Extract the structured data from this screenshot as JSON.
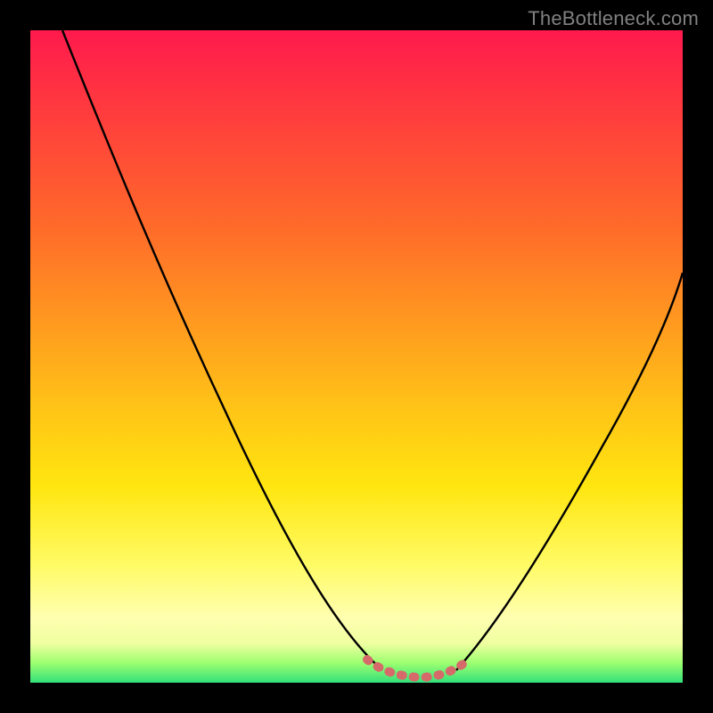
{
  "watermark": "TheBottleneck.com",
  "chart_data": {
    "type": "line",
    "title": "",
    "xlabel": "",
    "ylabel": "",
    "xlim": [
      0,
      100
    ],
    "ylim": [
      0,
      100
    ],
    "grid": false,
    "legend": false,
    "series": [
      {
        "name": "left-curve",
        "color": "#000000",
        "x": [
          5,
          10,
          15,
          20,
          25,
          30,
          35,
          40,
          45,
          50,
          53,
          55
        ],
        "y": [
          100,
          90,
          80,
          70,
          60,
          50,
          40,
          30,
          20,
          10,
          3,
          1
        ]
      },
      {
        "name": "right-curve",
        "color": "#000000",
        "x": [
          65,
          68,
          72,
          76,
          80,
          84,
          88,
          92,
          96,
          100
        ],
        "y": [
          1,
          4,
          10,
          17,
          24,
          32,
          40,
          48,
          56,
          63
        ]
      },
      {
        "name": "bottom-dots",
        "color": "#d66a6a",
        "style": "dotted",
        "x": [
          51,
          53,
          55,
          57,
          59,
          61,
          63,
          65,
          67
        ],
        "y": [
          2.5,
          1.2,
          0.8,
          0.7,
          0.7,
          0.7,
          0.8,
          1.2,
          2.5
        ]
      }
    ],
    "annotations": []
  }
}
